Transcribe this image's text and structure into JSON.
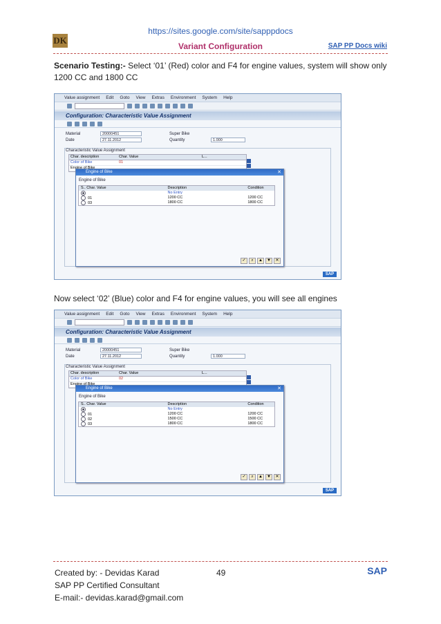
{
  "header": {
    "url": "https://sites.google.com/site/sapppdocs",
    "logo": "DK",
    "title": "Variant Configuration",
    "wiki_link": "SAP PP Docs wiki"
  },
  "para1": {
    "bold": "Scenario Testing:-",
    "text": " Select ‘01’ (Red) color and F4 for engine values, system will show only 1200 CC and 1800 CC"
  },
  "para2": "Now select ‘02’ (Blue) color and F4 for engine values, you will see all engines",
  "sap_common": {
    "menu": [
      "Value assignment",
      "Edit",
      "Goto",
      "View",
      "Extras",
      "Environment",
      "System",
      "Help"
    ],
    "screen_title": "Configuration: Characteristic Value Assignment",
    "material_label": "Material",
    "material_value": "20000451",
    "material_desc": "Super Bike",
    "date_label": "Date",
    "date_value": "27.11.2012",
    "quantity_label": "Quantity",
    "quantity_value": "1.000",
    "group_title": "Characteristic Value Assignment",
    "col_desc": "Char. description",
    "col_value": "Char. Value",
    "col_l": "L...",
    "row1": "Color of Bike",
    "row2": "Engine of Bike",
    "popup_title": "Engine of Bike",
    "popup_sub": "Engine of Bike",
    "p_col1": "S.. Char. Value",
    "p_col2": "Description",
    "p_col3": "Condition",
    "no_entry": "No Entry",
    "sap_logo": "SAP"
  },
  "screen1": {
    "color_value": "01",
    "options": [
      {
        "code": "01",
        "desc": "1200 CC",
        "cond": "1200 CC"
      },
      {
        "code": "03",
        "desc": "1800 CC",
        "cond": "1800 CC"
      }
    ]
  },
  "screen2": {
    "color_value": "02",
    "options": [
      {
        "code": "01",
        "desc": "1200 CC",
        "cond": "1200 CC"
      },
      {
        "code": "02",
        "desc": "1500 CC",
        "cond": "1500 CC"
      },
      {
        "code": "03",
        "desc": "1800 CC",
        "cond": "1800 CC"
      }
    ]
  },
  "footer": {
    "created_by": "Created by: - Devidas Karad",
    "certified": "SAP PP Certified Consultant",
    "email": "E-mail:- devidas.karad@gmail.com",
    "page_number": "49",
    "sap": "SAP"
  },
  "colors": {
    "accent_blue": "#2f5fb3",
    "title_pink": "#b0306a",
    "dash_red": "#c0504d"
  }
}
